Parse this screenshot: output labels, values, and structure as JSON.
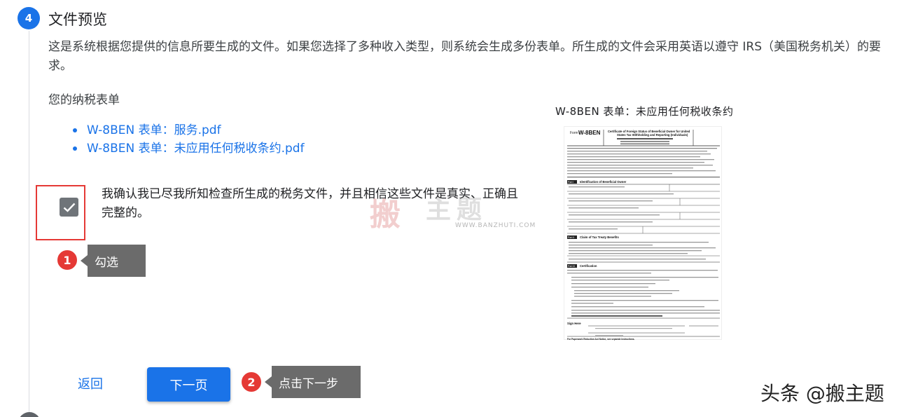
{
  "step": {
    "number": "4",
    "title": "文件预览",
    "description": "这是系统根据您提供的信息所要生成的文件。如果您选择了多种收入类型，则系统会生成多份表单。所生成的文件会采用英语以遵守 IRS（美国税务机关）的要求。",
    "forms_heading": "您的纳税表单",
    "files": [
      "W-8BEN 表单：服务.pdf",
      "W-8BEN 表单：未应用任何税收条约.pdf"
    ],
    "confirm_text": "我确认我已尽我所知检查所生成的税务文件，并且相信这些文件是真实、正确且完整的。",
    "confirm_checked": true,
    "back_label": "返回",
    "next_label": "下一页"
  },
  "annotations": [
    {
      "number": "1",
      "label": "勾选"
    },
    {
      "number": "2",
      "label": "点击下一步"
    }
  ],
  "preview": {
    "title": "W-8BEN 表单：未应用任何税收条约",
    "form_name": "W-8BEN",
    "form_heading": "Certificate of Foreign Status of Beneficial Owner for United States Tax Withholding and Reporting (Individuals)",
    "part_labels": [
      "Part I",
      "Part II",
      "Part III"
    ],
    "part_titles": [
      "Identification of Beneficial Owner",
      "Claim of Tax Treaty Benefits",
      "Certification"
    ],
    "sign_label": "Sign Here",
    "footer_text": "For Paperwork Reduction Act Notice, see separate instructions."
  },
  "watermark": {
    "logo_char": "搬",
    "text": "主题",
    "url": "WWW.BANZHUTI.COM"
  },
  "footer_mark": "头条 @搬主题",
  "colors": {
    "accent": "#1a73e8",
    "highlight": "#e53935",
    "tooltip": "#6b6b6b"
  }
}
